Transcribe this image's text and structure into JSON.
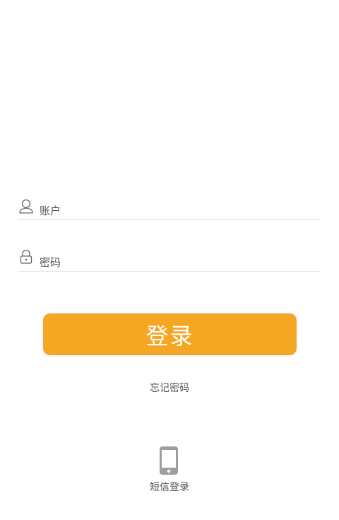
{
  "login_form": {
    "account": {
      "icon": "user-icon",
      "placeholder": "账户",
      "value": ""
    },
    "password": {
      "icon": "lock-icon",
      "placeholder": "密码",
      "value": ""
    },
    "login_button_label": "登录",
    "forgot_password_label": "忘记密码",
    "sms_login": {
      "icon": "phone-icon",
      "label": "短信登录"
    }
  },
  "colors": {
    "accent": "#f5a623",
    "text": "#555555",
    "divider": "#e2e2e2",
    "icon": "#999999"
  }
}
